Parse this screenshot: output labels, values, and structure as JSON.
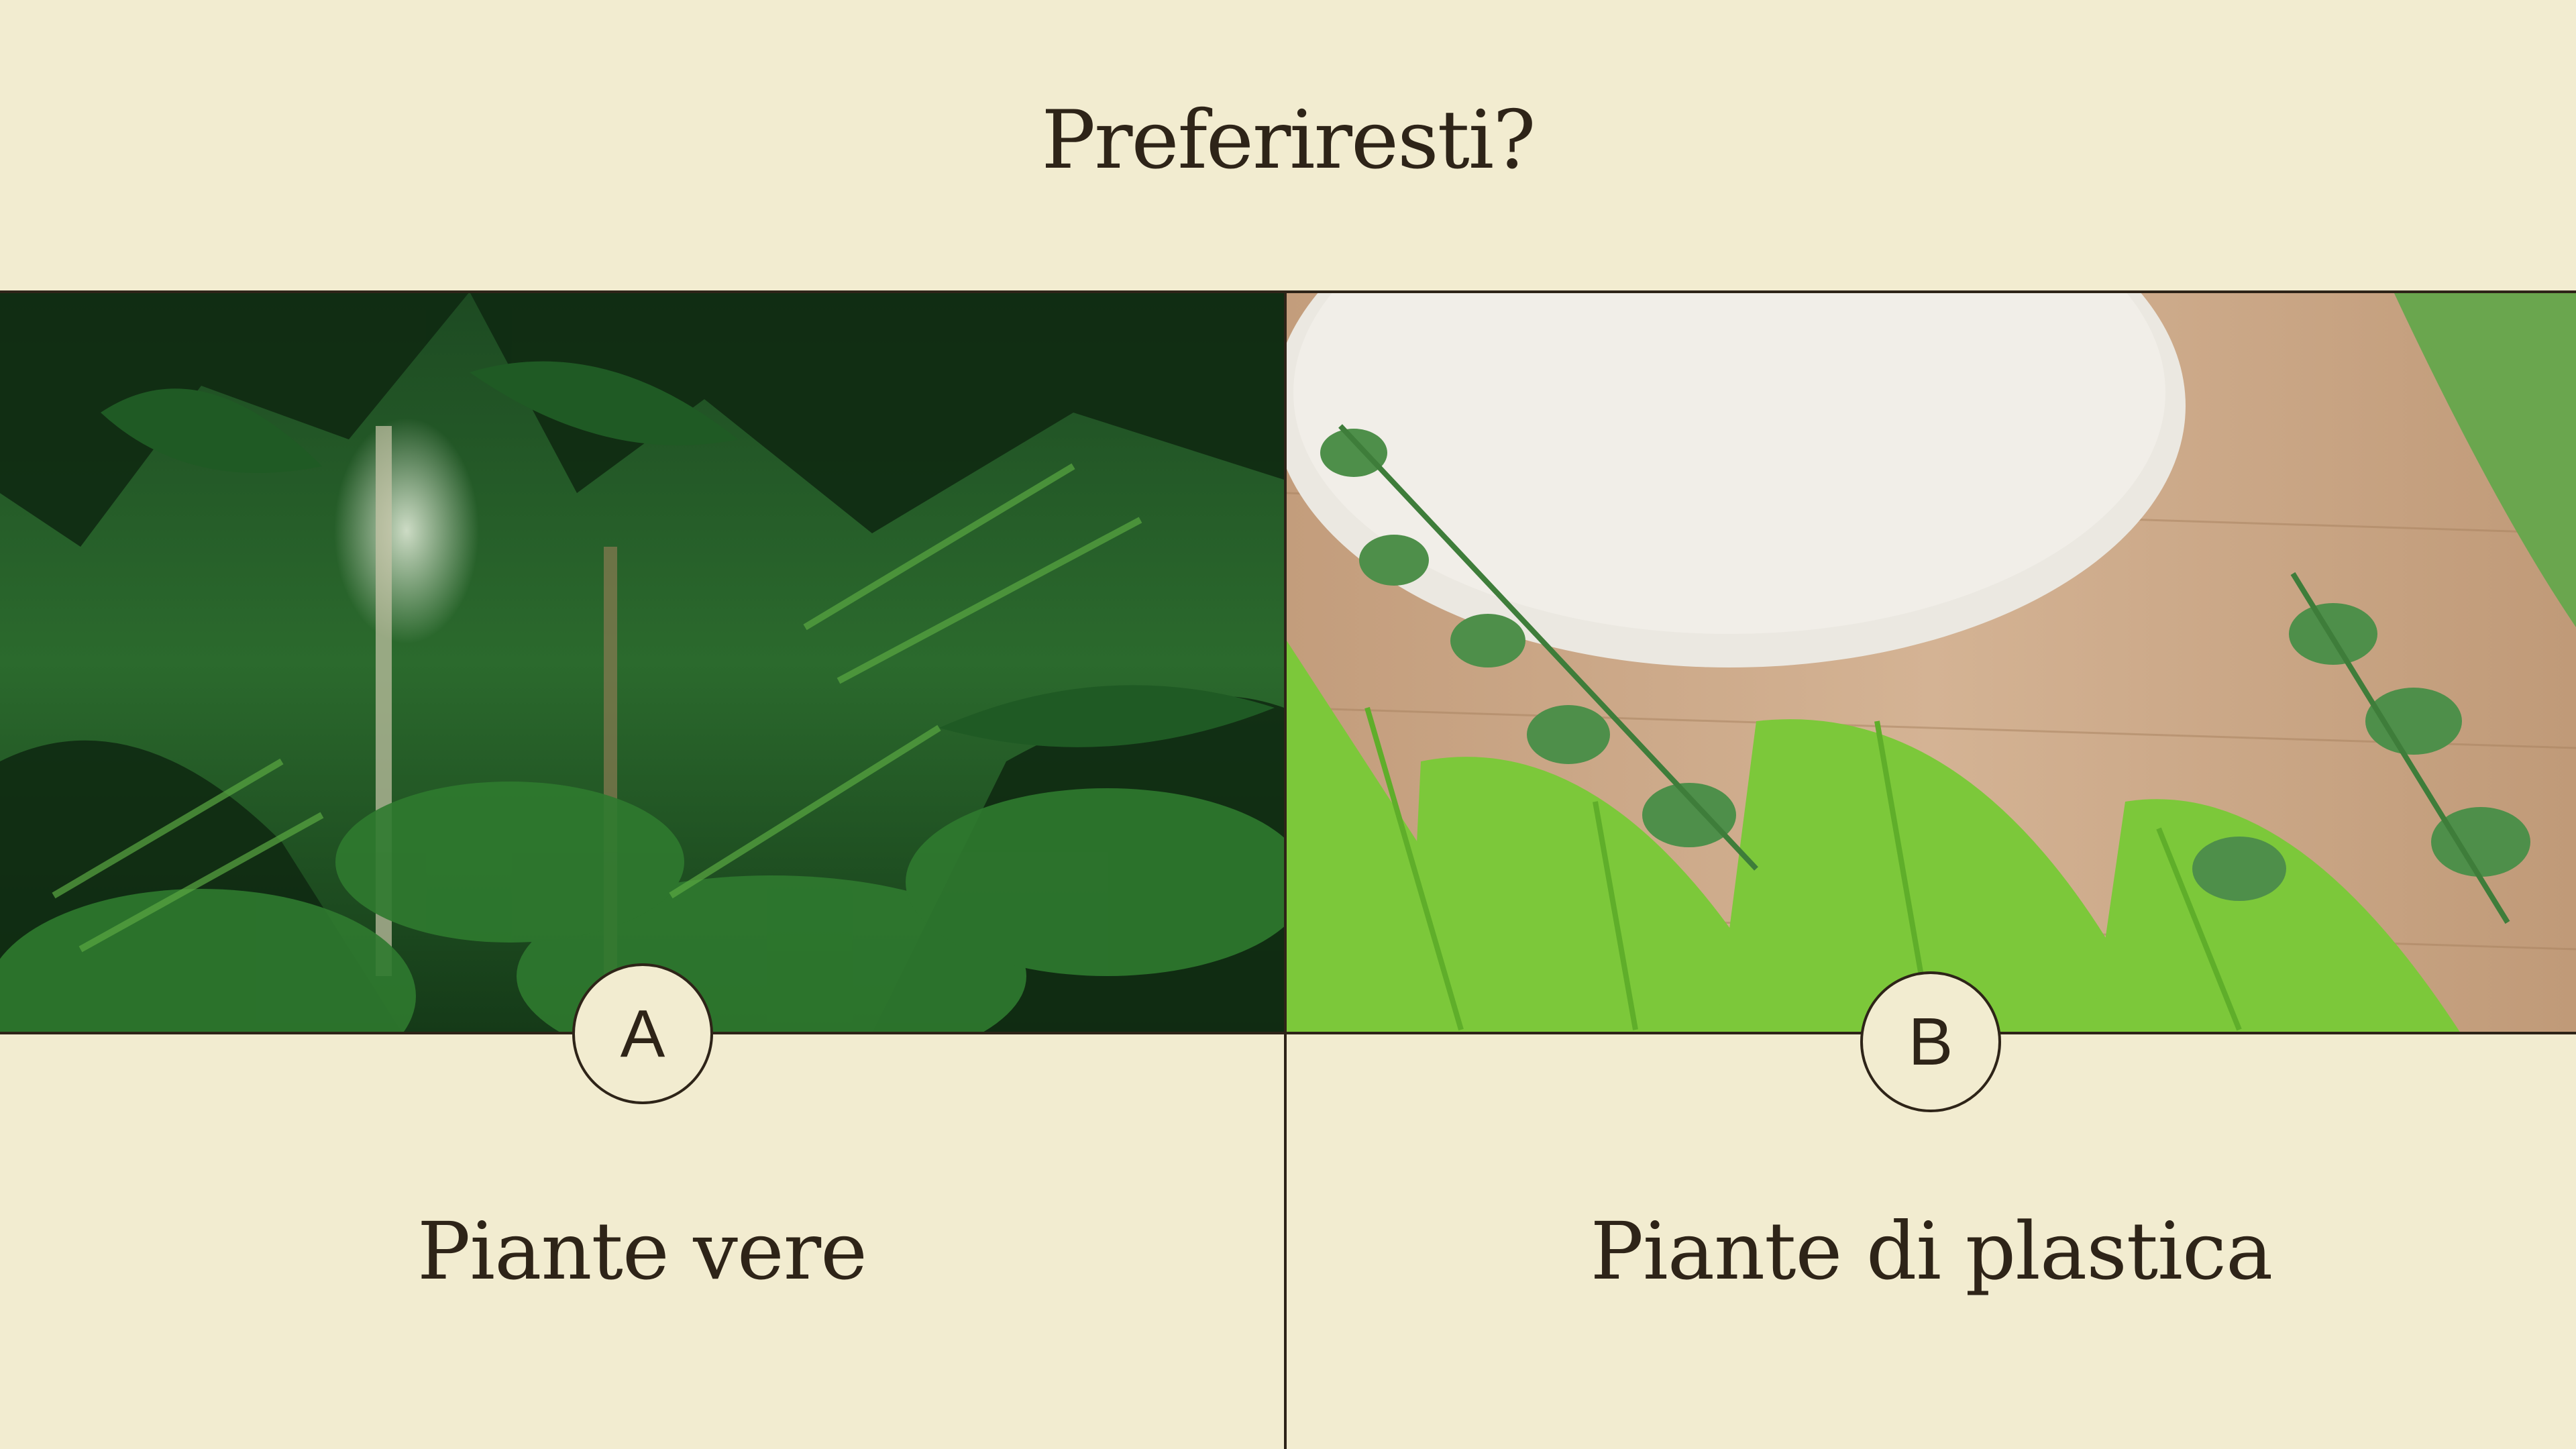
{
  "slide": {
    "title": "Preferiresti?",
    "options": [
      {
        "badge": "A",
        "label": "Piante vere",
        "image": "dense tropical jungle plants",
        "colors": {
          "dark": "#0f2a12",
          "mid": "#1f5a24",
          "light": "#4f9a3c"
        }
      },
      {
        "badge": "B",
        "label": "Piante di plastica",
        "image": "artificial plastic ferns and leaves on wood with white round plate",
        "colors": {
          "wood": "#c9a585",
          "plate": "#ece9e2",
          "fern": "#7cc83a",
          "leaf": "#4e8f4a"
        }
      }
    ]
  },
  "theme": {
    "background": "#f2ecd0",
    "ink": "#2e2418"
  }
}
